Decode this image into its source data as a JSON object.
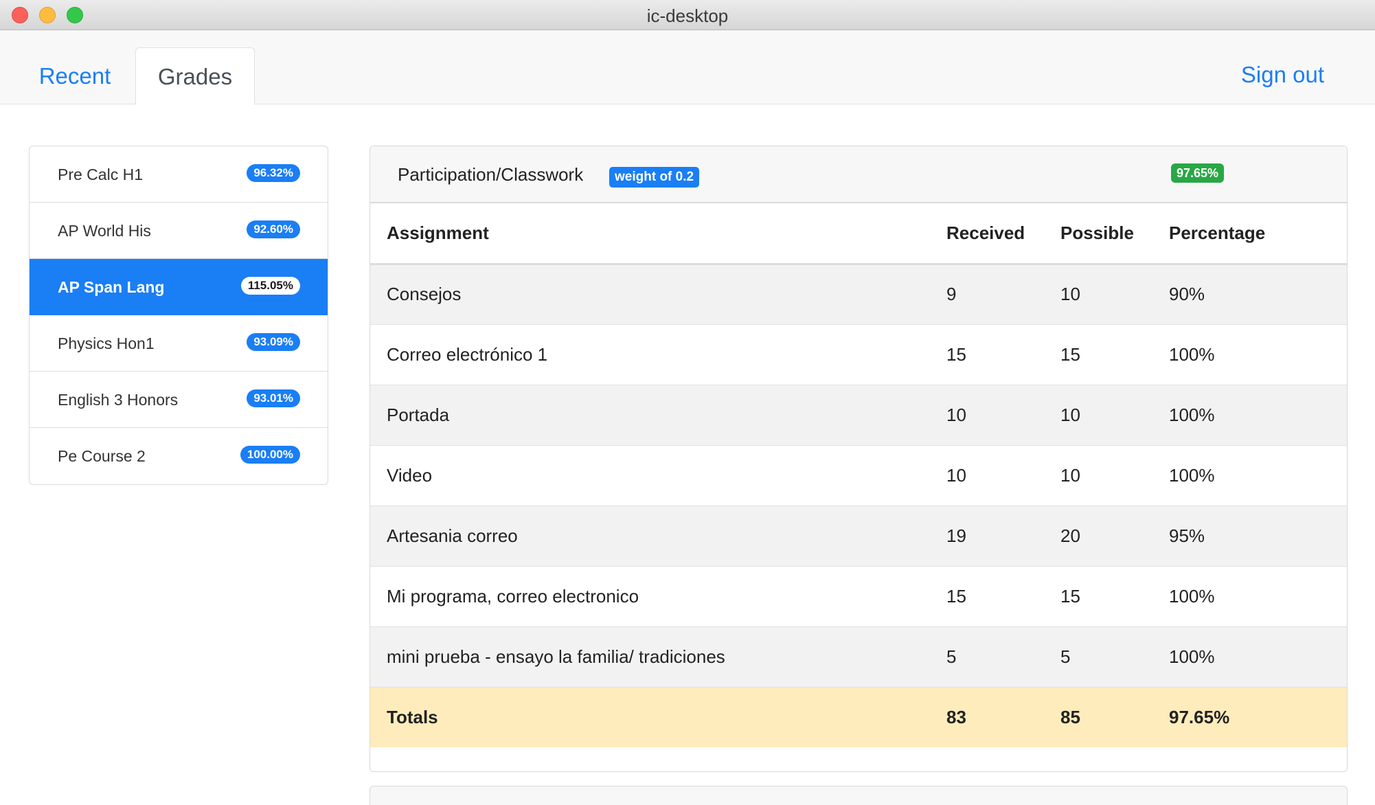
{
  "window": {
    "title": "ic-desktop"
  },
  "nav": {
    "tabs": [
      {
        "label": "Recent"
      },
      {
        "label": "Grades"
      }
    ],
    "signout_label": "Sign out"
  },
  "courses": [
    {
      "name": "Pre Calc H1",
      "grade": "96.32%"
    },
    {
      "name": "AP World His",
      "grade": "92.60%"
    },
    {
      "name": "AP Span Lang",
      "grade": "115.05%"
    },
    {
      "name": "Physics Hon1",
      "grade": "93.09%"
    },
    {
      "name": "English 3 Honors",
      "grade": "93.01%"
    },
    {
      "name": "Pe Course 2",
      "grade": "100.00%"
    }
  ],
  "category": {
    "name": "Participation/Classwork",
    "weight_label": "weight of 0.2",
    "percentage": "97.65%",
    "columns": [
      "Assignment",
      "Received",
      "Possible",
      "Percentage"
    ],
    "rows": [
      {
        "assignment": "Consejos",
        "received": "9",
        "possible": "10",
        "percentage": "90%"
      },
      {
        "assignment": "Correo electrónico 1",
        "received": "15",
        "possible": "15",
        "percentage": "100%"
      },
      {
        "assignment": "Portada",
        "received": "10",
        "possible": "10",
        "percentage": "100%"
      },
      {
        "assignment": "Video",
        "received": "10",
        "possible": "10",
        "percentage": "100%"
      },
      {
        "assignment": "Artesania correo",
        "received": "19",
        "possible": "20",
        "percentage": "95%"
      },
      {
        "assignment": "Mi programa, correo electronico",
        "received": "15",
        "possible": "15",
        "percentage": "100%"
      },
      {
        "assignment": "mini prueba - ensayo la familia/ tradiciones",
        "received": "5",
        "possible": "5",
        "percentage": "100%"
      }
    ],
    "totals": {
      "label": "Totals",
      "received": "83",
      "possible": "85",
      "percentage": "97.65%"
    }
  },
  "colors": {
    "accent": "#1a7ef5",
    "success": "#29a745",
    "totals_row": "#ffecbc"
  }
}
